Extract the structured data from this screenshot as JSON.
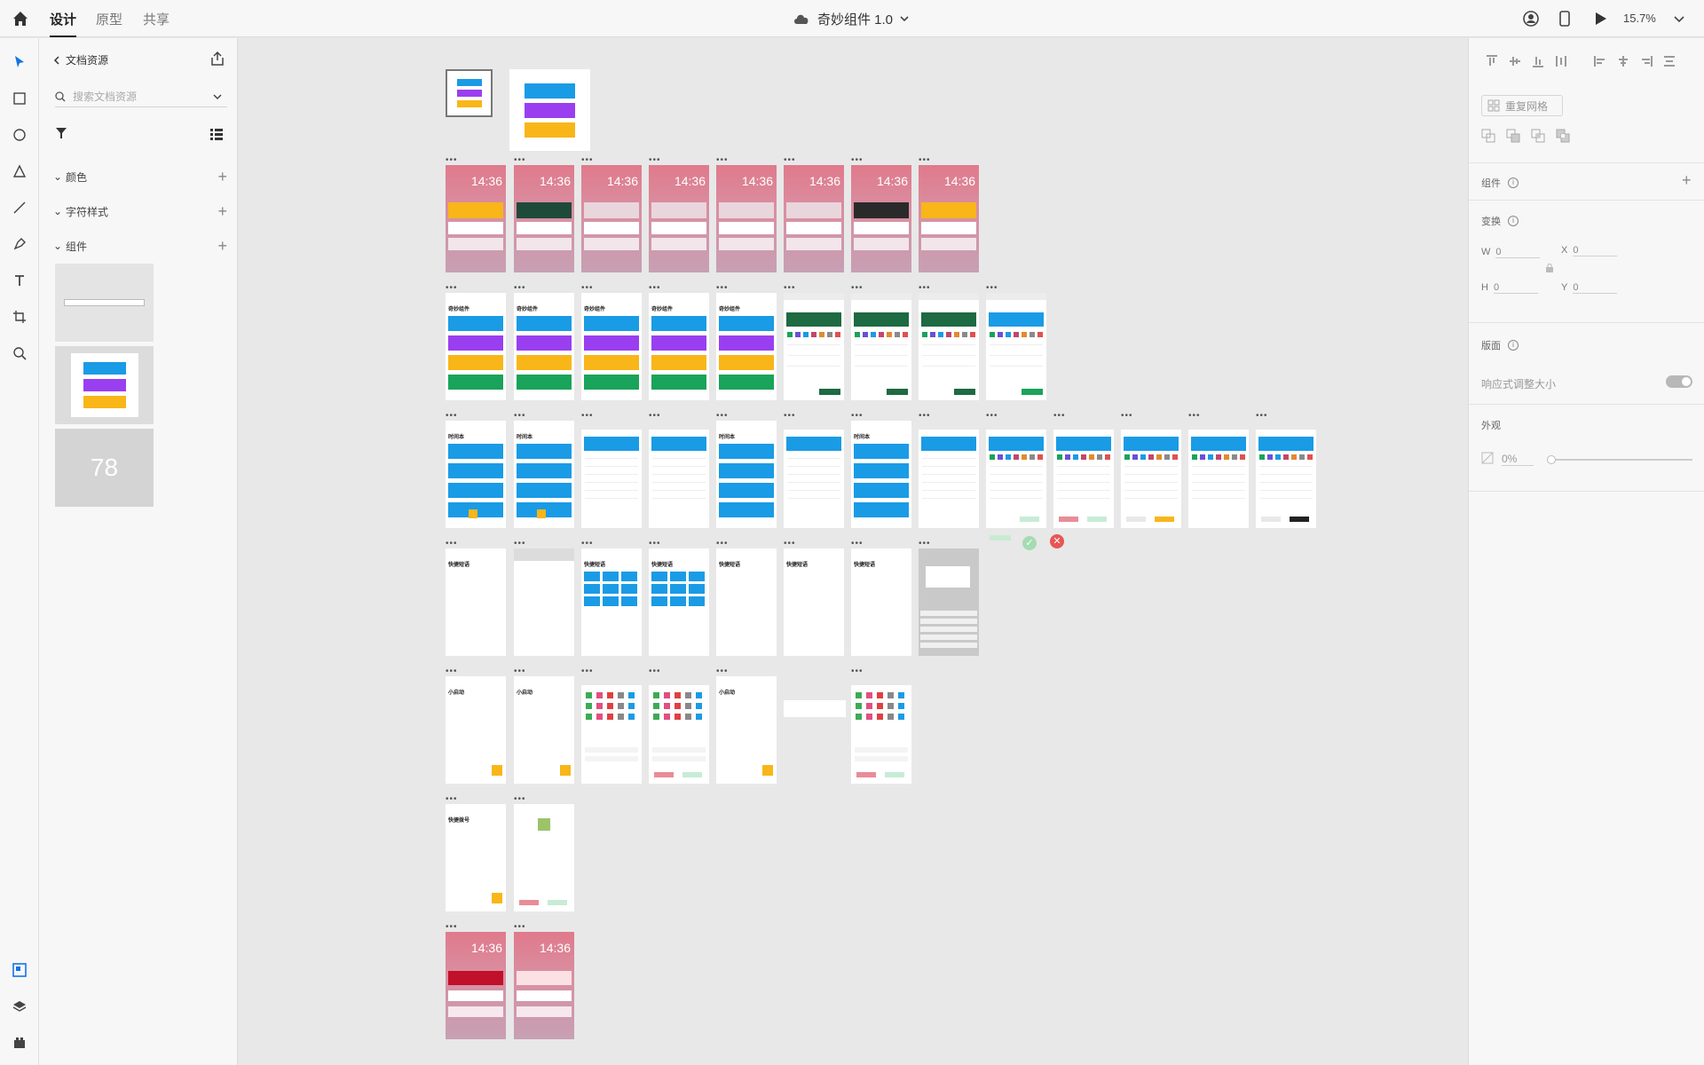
{
  "topbar": {
    "tabs": [
      {
        "label": "设计",
        "active": true
      },
      {
        "label": "原型",
        "active": false
      },
      {
        "label": "共享",
        "active": false
      }
    ],
    "doc_title": "奇妙组件 1.0",
    "zoom": "15.7%"
  },
  "assets_panel": {
    "back_label": "文档资源",
    "search_placeholder": "搜索文档资源",
    "sections": [
      {
        "label": "颜色"
      },
      {
        "label": "字符样式"
      },
      {
        "label": "组件"
      }
    ],
    "component_count": "78"
  },
  "canvas": {
    "lockscreen_time": "14:36",
    "labels": {
      "wonder": "奇妙组件",
      "timebook": "时间本",
      "quick_phrase": "快捷短语",
      "mini_launch": "小启动",
      "quick_dial": "快捷拨号"
    }
  },
  "props_panel": {
    "repeat_grid": "重复网格",
    "component": "组件",
    "transform": "变换",
    "w_label": "W",
    "w_value": "0",
    "h_label": "H",
    "h_value": "0",
    "x_label": "X",
    "x_value": "0",
    "y_label": "Y",
    "y_value": "0",
    "layout": "版面",
    "responsive_resize": "响应式调整大小",
    "appearance": "外观",
    "opacity": "0%"
  },
  "colors": {
    "blue": "#1a9be6",
    "purple": "#9a3ff0",
    "yellow": "#f8b619",
    "green": "#1aa35a",
    "dark_green": "#1e6a42",
    "pink": "#e07a8c",
    "accent_select": "#1473e6"
  }
}
